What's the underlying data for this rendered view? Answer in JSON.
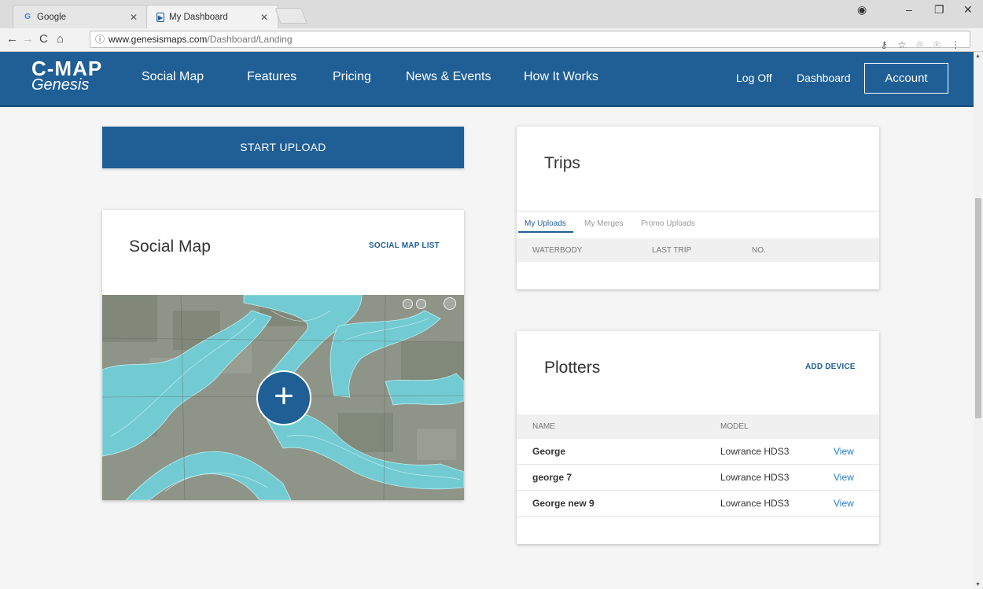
{
  "browser": {
    "tabs": [
      {
        "title": "Google",
        "favicon": "G",
        "active": false
      },
      {
        "title": "My Dashboard",
        "favicon": "dashboard-icon",
        "active": true
      }
    ],
    "url_host": "www.genesismaps.com",
    "url_path": "/Dashboard/Landing"
  },
  "header": {
    "logo_top": "C-MAP",
    "logo_bottom": "Genesis",
    "nav": [
      "Social Map",
      "Features",
      "Pricing",
      "News & Events",
      "How It Works"
    ],
    "log_off": "Log Off",
    "dashboard": "Dashboard",
    "account": "Account"
  },
  "upload": {
    "label": "START UPLOAD"
  },
  "social_map": {
    "title": "Social Map",
    "list_link": "SOCIAL MAP LIST",
    "add_icon": "plus-icon"
  },
  "trips": {
    "title": "Trips",
    "tabs": [
      "My Uploads",
      "My Merges",
      "Promo Uploads"
    ],
    "active_tab": "My Uploads",
    "columns": [
      "WATERBODY",
      "LAST TRIP",
      "NO."
    ]
  },
  "plotters": {
    "title": "Plotters",
    "add_link": "ADD DEVICE",
    "columns": [
      "NAME",
      "MODEL"
    ],
    "rows": [
      {
        "name": "George",
        "model": "Lowrance HDS3",
        "action": "View"
      },
      {
        "name": "george 7",
        "model": "Lowrance HDS3",
        "action": "View"
      },
      {
        "name": "George new 9",
        "model": "Lowrance HDS3",
        "action": "View"
      }
    ]
  },
  "colors": {
    "brand": "#1f5f96",
    "link": "#1f7fc8",
    "water": "#6fd0d8"
  }
}
